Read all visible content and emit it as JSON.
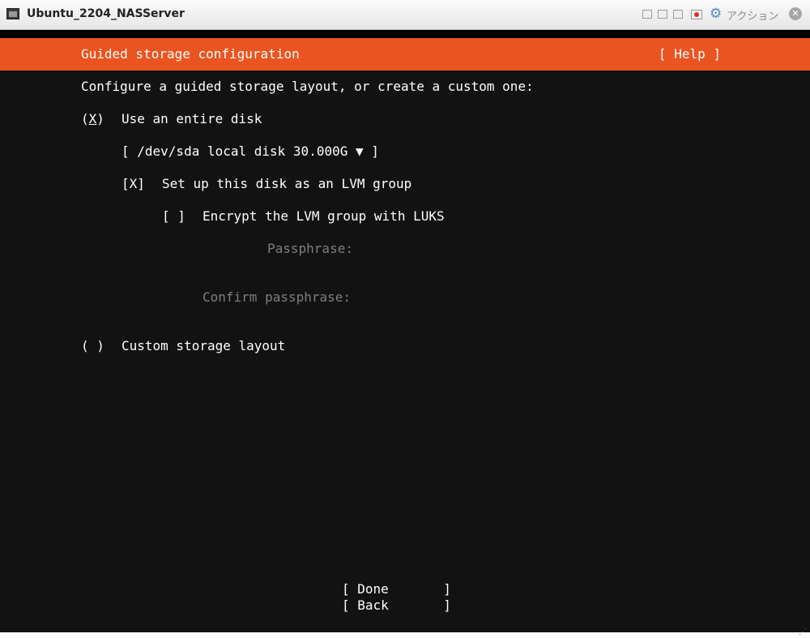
{
  "window": {
    "title": "Ubuntu_2204_NASServer",
    "action_label": "アクション",
    "close_glyph": "✕",
    "gear_glyph": "⚙"
  },
  "installer": {
    "header_title": "Guided storage configuration",
    "help_button": "[ Help ]",
    "prompt": "Configure a guided storage layout, or create a custom one:",
    "entire_disk": {
      "radio_open": "(",
      "radio_mark": "X",
      "radio_close": ")",
      "label": "Use an entire disk",
      "checked": true
    },
    "disk_select": {
      "text": "[ /dev/sda local disk 30.000G ▼ ]",
      "value": "/dev/sda local disk 30.000G"
    },
    "lvm": {
      "checkbox": "[X]",
      "label": "Set up this disk as an LVM group",
      "checked": true
    },
    "encrypt": {
      "checkbox": "[ ]",
      "label": "Encrypt the LVM group with LUKS",
      "checked": false
    },
    "passphrase_label": "Passphrase:",
    "confirm_passphrase_label": "Confirm passphrase:",
    "custom_layout": {
      "radio": "( )",
      "label": "Custom storage layout",
      "checked": false
    },
    "done_button": "[ Done       ]",
    "back_button": "[ Back       ]"
  },
  "colors": {
    "accent": "#e95420",
    "terminal_bg": "#121212",
    "text": "#ffffff",
    "disabled_text": "#7e7e7e"
  }
}
